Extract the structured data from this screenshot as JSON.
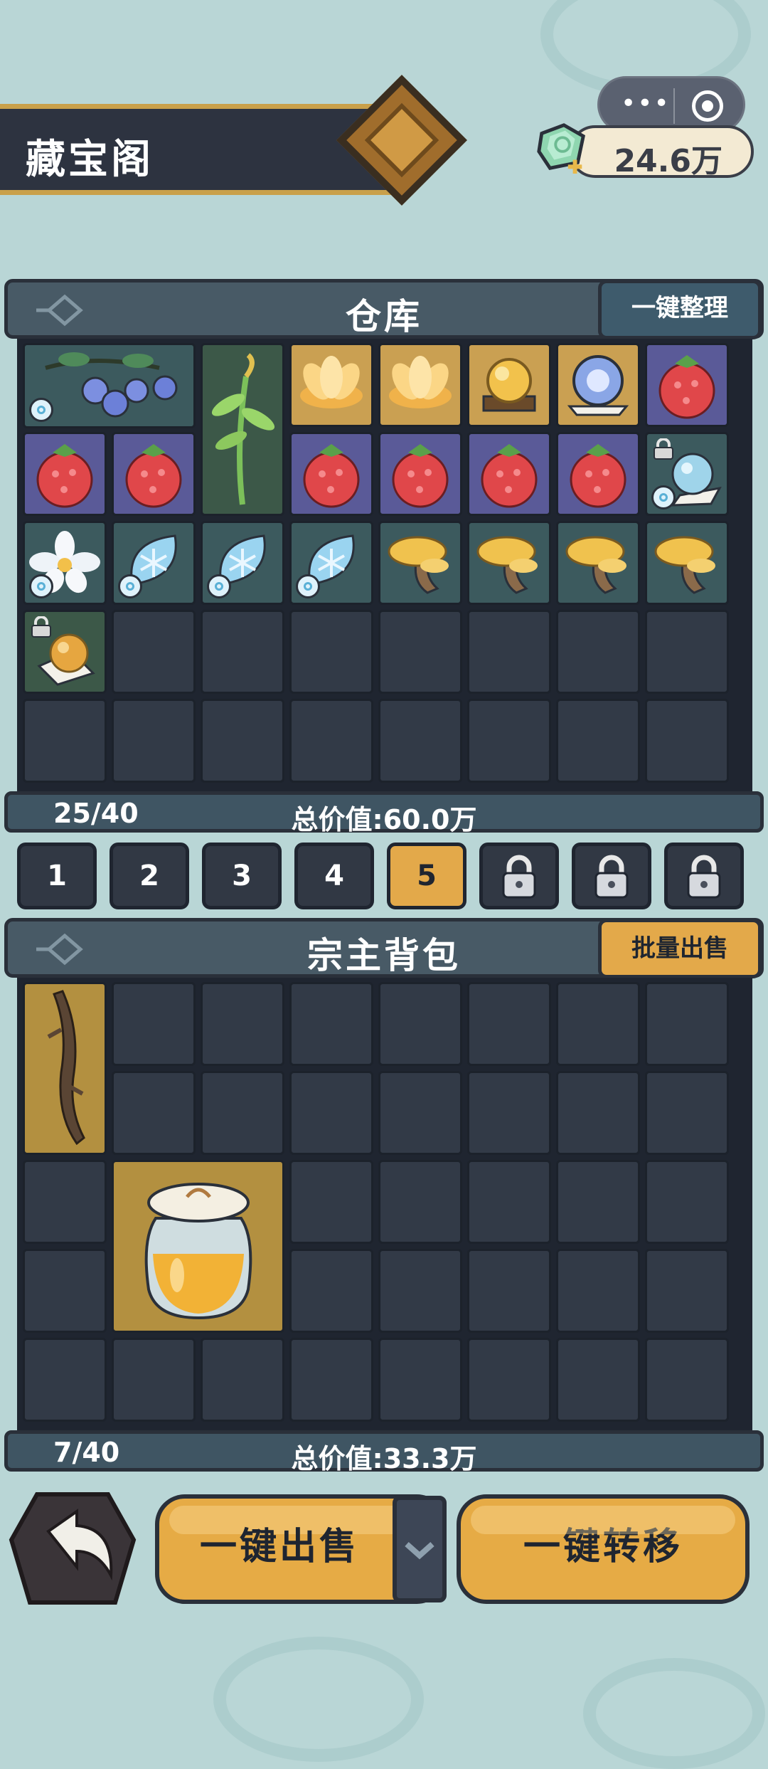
{
  "header": {
    "title": "藏宝阁"
  },
  "currency": {
    "value": "24.6万",
    "icon": "spirit-stone-gem-icon"
  },
  "capsule": {
    "more": "•••",
    "icon": "target-icon"
  },
  "warehouse": {
    "title": "仓库",
    "sort_button": "一键整理",
    "count": "25/40",
    "total": "总价值:60.0万"
  },
  "pages": {
    "tabs": [
      "1",
      "2",
      "3",
      "4",
      "5"
    ],
    "active": "5",
    "locked_tabs": 3
  },
  "bag": {
    "title": "宗主背包",
    "sell_button": "批量出售",
    "count": "7/40",
    "total": "总价值:33.3万"
  },
  "actions": {
    "sell_all": "一键出售",
    "transfer_all": "一键转移",
    "back_icon": "back-arrow-icon",
    "dropdown_icon": "chevron-down-icon"
  }
}
